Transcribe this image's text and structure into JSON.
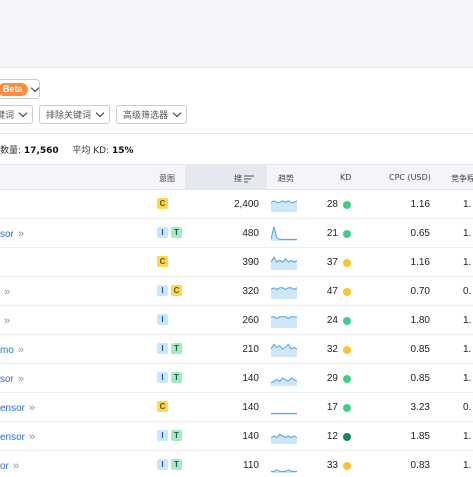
{
  "beta_label": "Beta",
  "filters": [
    {
      "label": "关键词"
    },
    {
      "label": "排除关键词"
    },
    {
      "label": "高级筛选器"
    }
  ],
  "summary": {
    "count_label": "数量:",
    "count_value": "17,560",
    "kd_label": "平均 KD:",
    "kd_value": "15%"
  },
  "columns": {
    "intent": "意图",
    "volume": "搜",
    "trend": "趋势",
    "kd": "KD",
    "cpc": "CPC (USD)",
    "competition": "竞争程"
  },
  "colors": {
    "link": "#2b6fd6",
    "kd_green": "#3ccf8e",
    "kd_dark_green": "#0f8a5b",
    "kd_yellow": "#ffc22e",
    "trend_line": "#4da3e0",
    "trend_fill": "#cfe6f7"
  },
  "rows": [
    {
      "keyword": "",
      "more": "",
      "intents": [
        "C"
      ],
      "volume": "2,400",
      "trend": [
        6,
        7,
        6,
        6,
        7,
        6,
        7,
        6,
        6,
        7
      ],
      "kd": "28",
      "kd_color": "#3ccf8e",
      "cpc": "1.16",
      "competition": "1."
    },
    {
      "keyword": "sor",
      "more": "»",
      "intents": [
        "I",
        "T"
      ],
      "volume": "480",
      "trend": [
        1,
        9,
        2,
        1,
        1,
        1,
        1,
        1,
        1,
        1
      ],
      "kd": "21",
      "kd_color": "#3ccf8e",
      "cpc": "0.65",
      "competition": "1."
    },
    {
      "keyword": "",
      "more": "",
      "intents": [
        "C"
      ],
      "volume": "390",
      "trend": [
        5,
        8,
        5,
        6,
        5,
        7,
        5,
        6,
        5,
        6
      ],
      "kd": "37",
      "kd_color": "#ffc22e",
      "cpc": "1.16",
      "competition": "1."
    },
    {
      "keyword": "",
      "more": "»",
      "intents": [
        "I",
        "C"
      ],
      "volume": "320",
      "trend": [
        6,
        7,
        6,
        7,
        7,
        6,
        7,
        7,
        6,
        7
      ],
      "kd": "47",
      "kd_color": "#ffc22e",
      "cpc": "0.70",
      "competition": "0."
    },
    {
      "keyword": "",
      "more": "»",
      "intents": [
        "I"
      ],
      "volume": "260",
      "trend": [
        7,
        7,
        6,
        7,
        7,
        7,
        6,
        7,
        7,
        7
      ],
      "kd": "24",
      "kd_color": "#3ccf8e",
      "cpc": "1.80",
      "competition": "1."
    },
    {
      "keyword": "mo",
      "more": "»",
      "intents": [
        "I",
        "T"
      ],
      "volume": "210",
      "trend": [
        5,
        8,
        6,
        7,
        5,
        6,
        8,
        5,
        6,
        5
      ],
      "kd": "32",
      "kd_color": "#ffc22e",
      "cpc": "0.85",
      "competition": "1."
    },
    {
      "keyword": "sor",
      "more": "»",
      "intents": [
        "I",
        "T"
      ],
      "volume": "140",
      "trend": [
        2,
        3,
        4,
        3,
        5,
        4,
        3,
        5,
        4,
        3
      ],
      "kd": "29",
      "kd_color": "#3ccf8e",
      "cpc": "0.85",
      "competition": "1."
    },
    {
      "keyword": "ensor",
      "more": "»",
      "intents": [
        "C"
      ],
      "volume": "140",
      "trend": [
        1,
        1,
        1,
        1,
        1,
        1,
        1,
        1,
        1,
        1
      ],
      "kd": "17",
      "kd_color": "#3ccf8e",
      "cpc": "3.23",
      "competition": "0."
    },
    {
      "keyword": "ensor",
      "more": "»",
      "intents": [
        "I",
        "T"
      ],
      "volume": "140",
      "trend": [
        4,
        5,
        4,
        6,
        5,
        4,
        5,
        4,
        5,
        4
      ],
      "kd": "12",
      "kd_color": "#0f8a5b",
      "cpc": "1.85",
      "competition": "1."
    },
    {
      "keyword": "or",
      "more": "»",
      "intents": [
        "I",
        "T"
      ],
      "volume": "110",
      "trend": [
        1,
        1,
        2,
        1,
        1,
        1,
        2,
        1,
        1,
        1
      ],
      "kd": "33",
      "kd_color": "#ffc22e",
      "cpc": "0.83",
      "competition": "1."
    }
  ]
}
